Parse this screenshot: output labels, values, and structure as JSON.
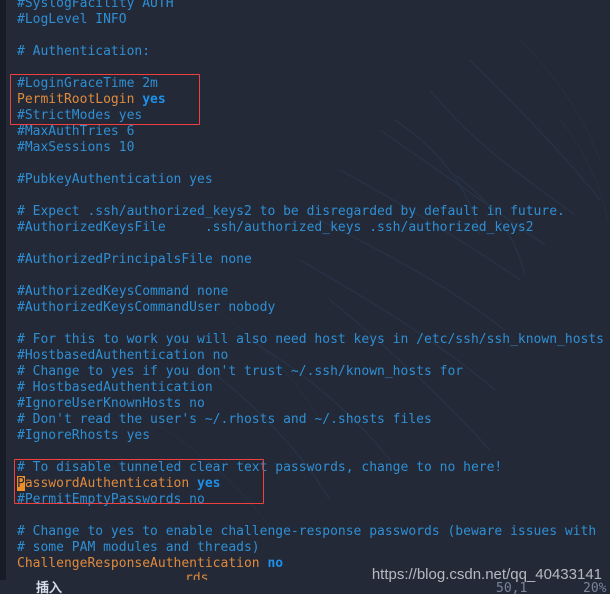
{
  "app": {
    "name": "vim-editor",
    "file_type": "sshd_config",
    "background_color": "#232937",
    "gutter_color": "#161b26",
    "comment_color": "#2f8fd4",
    "keyword_color": "#e08a3c",
    "value_color": "#1e90e8",
    "highlight_box_color": "#ef3f3f",
    "cursor_color": "#ef8e28"
  },
  "editor": {
    "lines": [
      {
        "segments": [
          {
            "text": "#SyslogFacility AUTH",
            "style": "cm"
          }
        ]
      },
      {
        "segments": [
          {
            "text": "#LogLevel INFO",
            "style": "cm"
          }
        ]
      },
      {
        "segments": [
          {
            "text": "",
            "style": "cm"
          }
        ]
      },
      {
        "segments": [
          {
            "text": "# Authentication:",
            "style": "cm"
          }
        ]
      },
      {
        "segments": [
          {
            "text": "",
            "style": "cm"
          }
        ]
      },
      {
        "segments": [
          {
            "text": "#LoginGraceTime 2m",
            "style": "cm"
          }
        ]
      },
      {
        "segments": [
          {
            "text": "PermitRootLogin ",
            "style": "kw"
          },
          {
            "text": "yes",
            "style": "val"
          }
        ]
      },
      {
        "segments": [
          {
            "text": "#StrictModes yes",
            "style": "cm"
          }
        ]
      },
      {
        "segments": [
          {
            "text": "#MaxAuthTries 6",
            "style": "cm"
          }
        ]
      },
      {
        "segments": [
          {
            "text": "#MaxSessions 10",
            "style": "cm"
          }
        ]
      },
      {
        "segments": [
          {
            "text": "",
            "style": "cm"
          }
        ]
      },
      {
        "segments": [
          {
            "text": "#PubkeyAuthentication yes",
            "style": "cm"
          }
        ]
      },
      {
        "segments": [
          {
            "text": "",
            "style": "cm"
          }
        ]
      },
      {
        "segments": [
          {
            "text": "# Expect .ssh/authorized_keys2 to be disregarded by default in future.",
            "style": "cm"
          }
        ]
      },
      {
        "segments": [
          {
            "text": "#AuthorizedKeysFile\t.ssh/authorized_keys .ssh/authorized_keys2",
            "style": "cm"
          }
        ]
      },
      {
        "segments": [
          {
            "text": "",
            "style": "cm"
          }
        ]
      },
      {
        "segments": [
          {
            "text": "#AuthorizedPrincipalsFile none",
            "style": "cm"
          }
        ]
      },
      {
        "segments": [
          {
            "text": "",
            "style": "cm"
          }
        ]
      },
      {
        "segments": [
          {
            "text": "#AuthorizedKeysCommand none",
            "style": "cm"
          }
        ]
      },
      {
        "segments": [
          {
            "text": "#AuthorizedKeysCommandUser nobody",
            "style": "cm"
          }
        ]
      },
      {
        "segments": [
          {
            "text": "",
            "style": "cm"
          }
        ]
      },
      {
        "segments": [
          {
            "text": "# For this to work you will also need host keys in /etc/ssh/ssh_known_hosts",
            "style": "cm"
          }
        ]
      },
      {
        "segments": [
          {
            "text": "#HostbasedAuthentication no",
            "style": "cm"
          }
        ]
      },
      {
        "segments": [
          {
            "text": "# Change to yes if you don't trust ~/.ssh/known_hosts for",
            "style": "cm"
          }
        ]
      },
      {
        "segments": [
          {
            "text": "# HostbasedAuthentication",
            "style": "cm"
          }
        ]
      },
      {
        "segments": [
          {
            "text": "#IgnoreUserKnownHosts no",
            "style": "cm"
          }
        ]
      },
      {
        "segments": [
          {
            "text": "# Don't read the user's ~/.rhosts and ~/.shosts files",
            "style": "cm"
          }
        ]
      },
      {
        "segments": [
          {
            "text": "#IgnoreRhosts yes",
            "style": "cm"
          }
        ]
      },
      {
        "segments": [
          {
            "text": "",
            "style": "cm"
          }
        ]
      },
      {
        "segments": [
          {
            "text": "# To disable tunneled clear text passwords, change to no here!",
            "style": "cm"
          }
        ]
      },
      {
        "segments": [
          {
            "text": "P",
            "style": "cursor"
          },
          {
            "text": "asswordAuthentication ",
            "style": "kw"
          },
          {
            "text": "yes",
            "style": "val"
          }
        ]
      },
      {
        "segments": [
          {
            "text": "#PermitEmptyPasswords no",
            "style": "cm"
          }
        ]
      },
      {
        "segments": [
          {
            "text": "",
            "style": "cm"
          }
        ]
      },
      {
        "segments": [
          {
            "text": "# Change to yes to enable challenge-response passwords (beware issues with",
            "style": "cm"
          }
        ]
      },
      {
        "segments": [
          {
            "text": "# some PAM modules and threads)",
            "style": "cm"
          }
        ]
      },
      {
        "segments": [
          {
            "text": "ChallengeResponseAuthentication ",
            "style": "kw"
          },
          {
            "text": "no",
            "style": "val"
          }
        ]
      }
    ],
    "highlight_boxes": [
      {
        "id": "hl-1",
        "label": "permit-root-login-highlight"
      },
      {
        "id": "hl-2",
        "label": "password-authentication-highlight"
      }
    ]
  },
  "statusbar": {
    "mode": "插入",
    "rowcol": "50,1",
    "percent": "20%",
    "fragment": "rds"
  },
  "watermark": {
    "text": "https://blog.csdn.net/qq_40433141"
  }
}
